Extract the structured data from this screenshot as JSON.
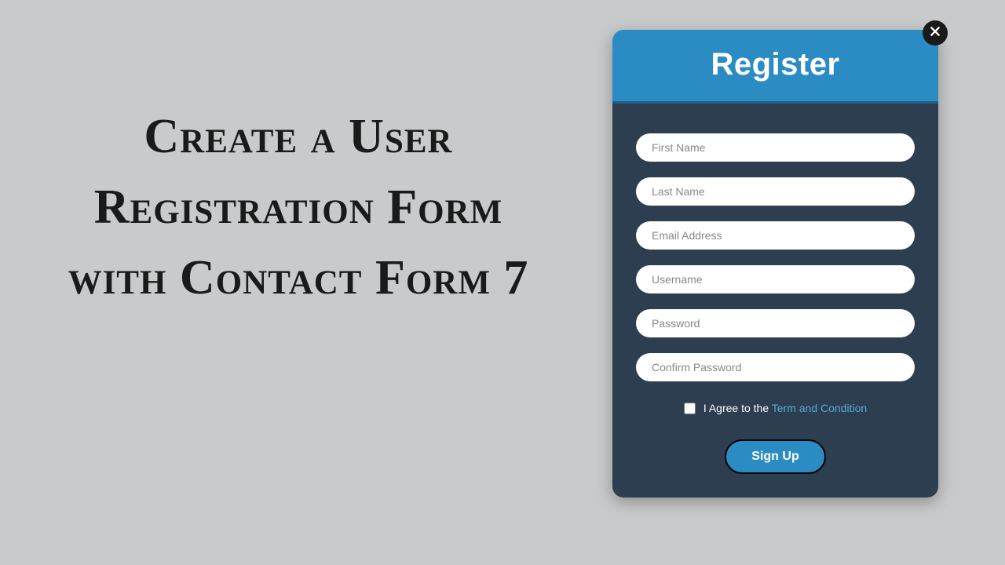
{
  "heading": "Create a User Registration Form with Contact Form 7",
  "modal": {
    "title": "Register",
    "fields": {
      "first_name": {
        "placeholder": "First Name",
        "value": ""
      },
      "last_name": {
        "placeholder": "Last Name",
        "value": ""
      },
      "email": {
        "placeholder": "Email Address",
        "value": ""
      },
      "username": {
        "placeholder": "Username",
        "value": ""
      },
      "password": {
        "placeholder": "Password",
        "value": ""
      },
      "confirm_password": {
        "placeholder": "Confirm Password",
        "value": ""
      }
    },
    "terms": {
      "prefix": "I Agree to the ",
      "link": "Term and Condition"
    },
    "submit_label": "Sign Up"
  },
  "colors": {
    "page_bg": "#c8cacb",
    "header_bg": "#2b8cc4",
    "body_bg": "#2c3e50",
    "link_color": "#5ba8d4"
  }
}
